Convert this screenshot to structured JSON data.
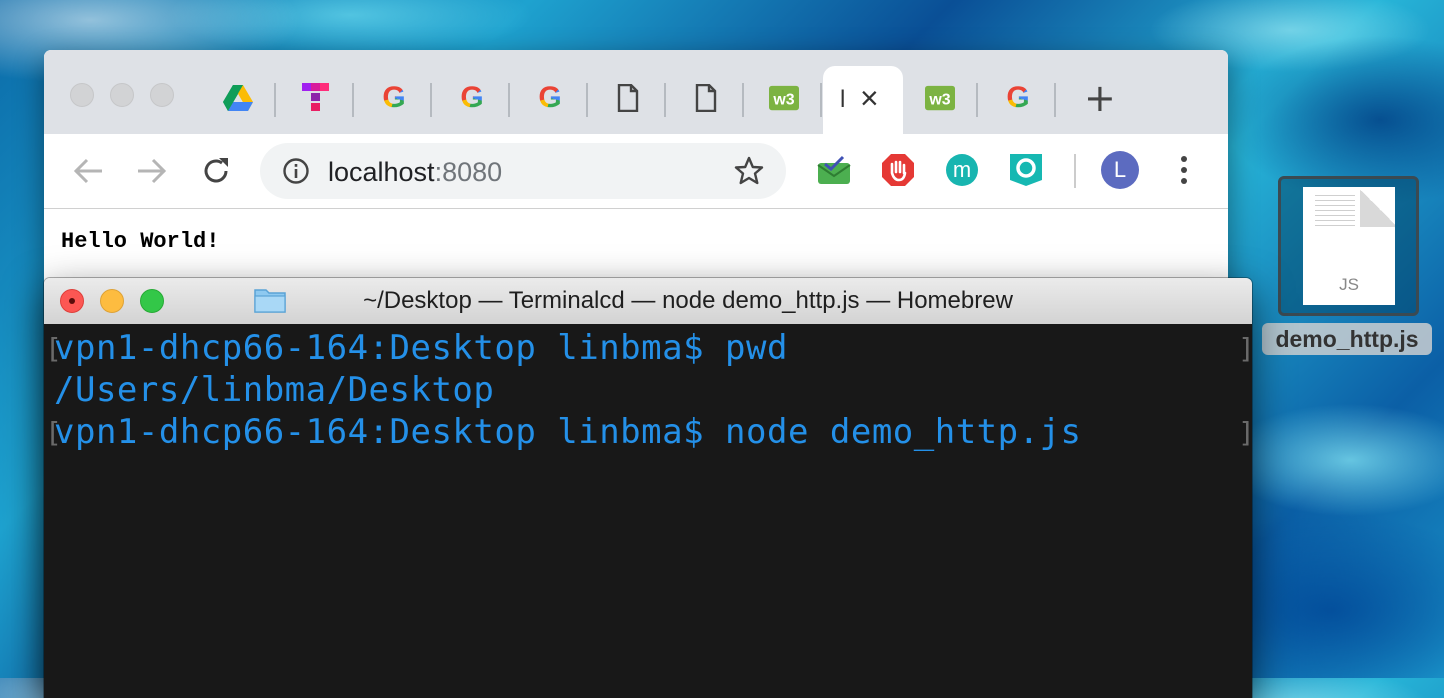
{
  "browser": {
    "tabs": [
      {
        "icon": "google-drive-icon"
      },
      {
        "icon": "t-logo-icon"
      },
      {
        "icon": "google-icon"
      },
      {
        "icon": "google-icon"
      },
      {
        "icon": "google-icon"
      },
      {
        "icon": "document-icon"
      },
      {
        "icon": "document-icon"
      },
      {
        "icon": "w3schools-icon"
      },
      {
        "icon": "",
        "active": true,
        "label": "l"
      },
      {
        "icon": "w3schools-icon"
      },
      {
        "icon": "google-icon"
      }
    ],
    "new_tab_label": "+",
    "close_label": "×",
    "url_host": "localhost",
    "url_port": ":8080",
    "avatar_letter": "L",
    "extension_m_label": "m",
    "page_text": "Hello World!"
  },
  "terminal": {
    "title": "~/Desktop — Terminalcd  — node demo_http.js — Homebrew",
    "lines": [
      "vpn1-dhcp66-164:Desktop linbma$ pwd",
      "/Users/linbma/Desktop",
      "vpn1-dhcp66-164:Desktop linbma$ node demo_http.js"
    ],
    "text_color": "#2490e8"
  },
  "desktop_file": {
    "name": "demo_http.js",
    "type_label": "JS"
  }
}
